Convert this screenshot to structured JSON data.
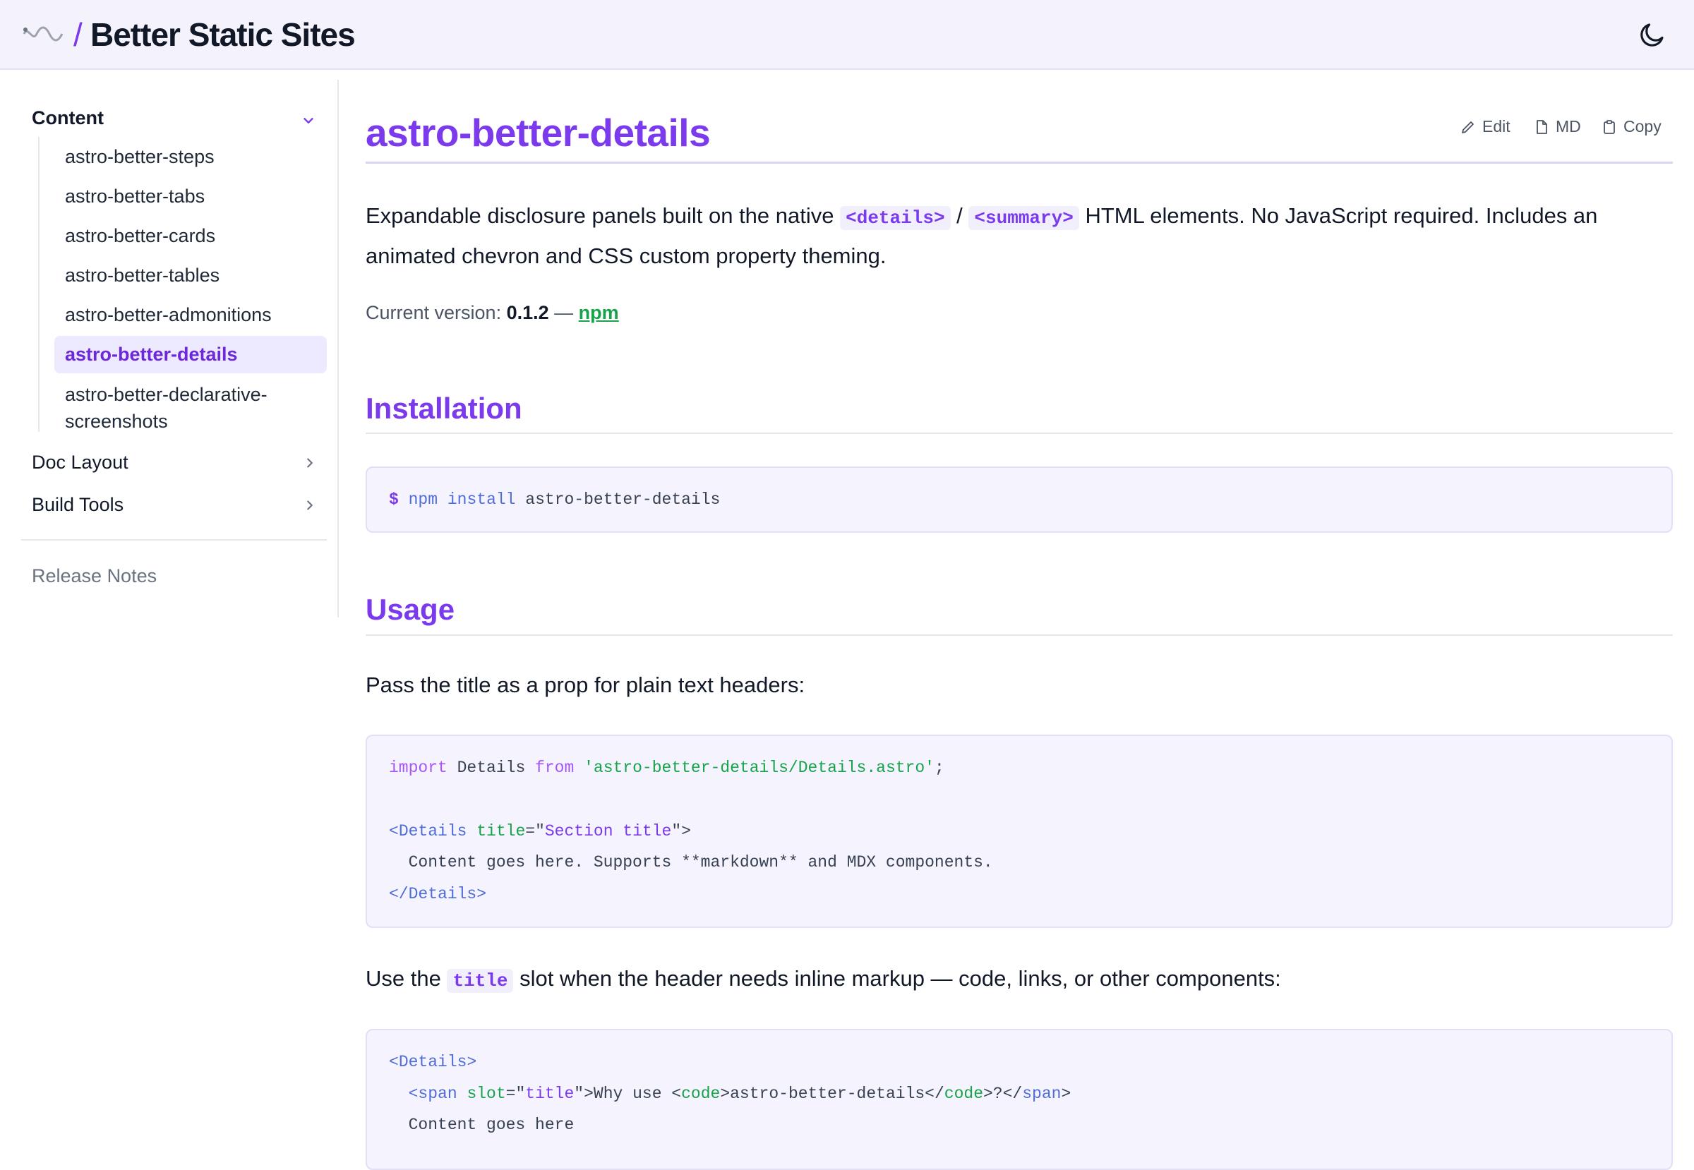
{
  "header": {
    "slash": "/",
    "site_title": "Better Static Sites"
  },
  "sidebar": {
    "sections": [
      {
        "label": "Content",
        "expanded": true
      },
      {
        "label": "Doc Layout",
        "expanded": false
      },
      {
        "label": "Build Tools",
        "expanded": false
      }
    ],
    "items": [
      {
        "label": "astro-better-steps"
      },
      {
        "label": "astro-better-tabs"
      },
      {
        "label": "astro-better-cards"
      },
      {
        "label": "astro-better-tables"
      },
      {
        "label": "astro-better-admonitions"
      },
      {
        "label": "astro-better-details",
        "active": true
      },
      {
        "label_line1": "astro-better-declarative-",
        "label_line2": "screenshots"
      }
    ],
    "release_notes": "Release Notes"
  },
  "main": {
    "title": "astro-better-details",
    "actions": {
      "edit": "Edit",
      "md": "MD",
      "copy": "Copy"
    },
    "intro": {
      "before": "Expandable disclosure panels built on the native ",
      "code1": "<details>",
      "sep": " / ",
      "code2": "<summary>",
      "after": " HTML elements. No JavaScript required. Includes an animated chevron and CSS custom property theming."
    },
    "version": {
      "label": "Current version: ",
      "number": "0.1.2",
      "dash": " — ",
      "link": "npm"
    },
    "installation": {
      "heading": "Installation",
      "prompt": "$",
      "cmd1": "npm",
      "cmd2": "install",
      "pkg": "astro-better-details"
    },
    "usage": {
      "heading": "Usage",
      "para1": "Pass the title as a prop for plain text headers:",
      "code1": {
        "l1_import": "import",
        "l1_name": " Details ",
        "l1_from": "from",
        "l1_str": " 'astro-better-details/Details.astro'",
        "l1_end": ";",
        "l2_open": "<",
        "l2_tag": "Details",
        "l2_attr": " title",
        "l2_eq": "=\"",
        "l2_val": "Section title",
        "l2_close": "\">",
        "l3": "  Content goes here. Supports **markdown** and MDX components.",
        "l4_open": "</",
        "l4_tag": "Details",
        "l4_close": ">"
      },
      "para2_before": "Use the ",
      "para2_code": "title",
      "para2_after": " slot when the header needs inline markup — code, links, or other components:",
      "code2": {
        "l1_open": "<",
        "l1_tag": "Details",
        "l1_close": ">",
        "l2_indent": "  <",
        "l2_tag": "span",
        "l2_attr": " slot",
        "l2_eq": "=\"",
        "l2_val": "title",
        "l2_mid": "\">Why use <",
        "l2_code": "code",
        "l2_mid2": ">astro-better-details</",
        "l2_code2": "code",
        "l2_mid3": ">?</",
        "l2_tag2": "span",
        "l2_end": ">",
        "l3": "  Content goes here"
      }
    }
  }
}
